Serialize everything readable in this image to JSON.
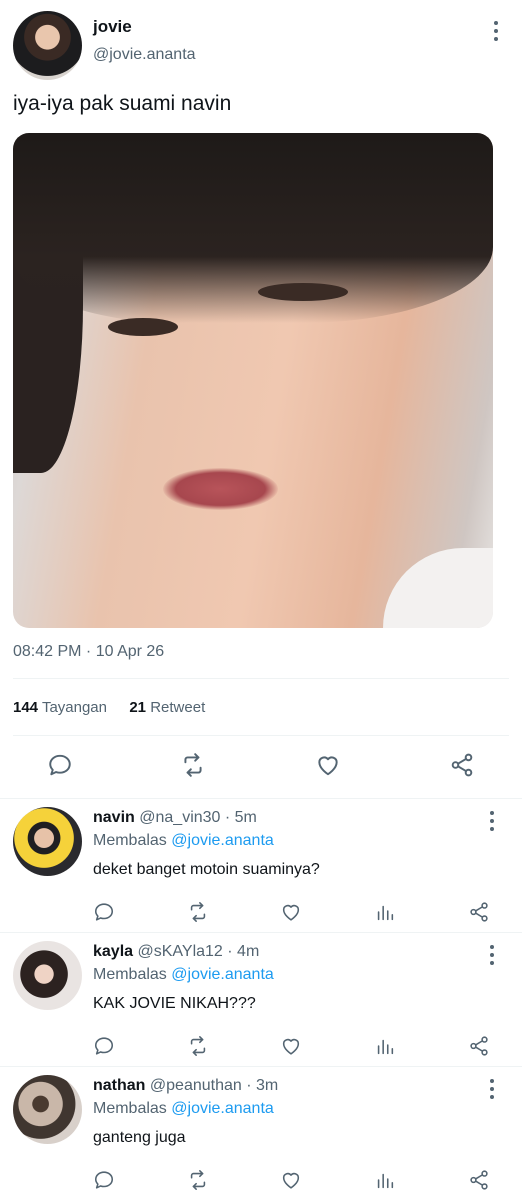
{
  "tweet": {
    "author_name": "jovie",
    "author_handle": "@jovie.ananta",
    "text": "iya-iya pak suami navin",
    "timestamp": "08:42 PM · 10 Apr 26",
    "views_count": "144",
    "views_label": "Tayangan",
    "retweets_count": "21",
    "retweets_label": "Retweet"
  },
  "actions": [
    "reply-icon",
    "retweet-icon",
    "like-icon",
    "share-icon"
  ],
  "reply_actions": [
    "reply-icon",
    "retweet-icon",
    "like-icon",
    "views-icon",
    "share-icon"
  ],
  "replies": [
    {
      "name": "navin",
      "handle_time": "@na_vin30 · 5m",
      "replying_label": "Membalas",
      "replying_to": "@jovie.ananta",
      "text": "deket banget motoin suaminya?"
    },
    {
      "name": "kayla",
      "handle_time": "@sKAYla12 · 4m",
      "replying_label": "Membalas",
      "replying_to": "@jovie.ananta",
      "text": "KAK JOVIE NIKAH???"
    },
    {
      "name": "nathan",
      "handle_time": "@peanuthan · 3m",
      "replying_label": "Membalas",
      "replying_to": "@jovie.ananta",
      "text": "ganteng juga"
    }
  ],
  "colors": {
    "text": "#0f1419",
    "secondary": "#536471",
    "link": "#1d9bf0",
    "divider": "#eff3f4"
  }
}
